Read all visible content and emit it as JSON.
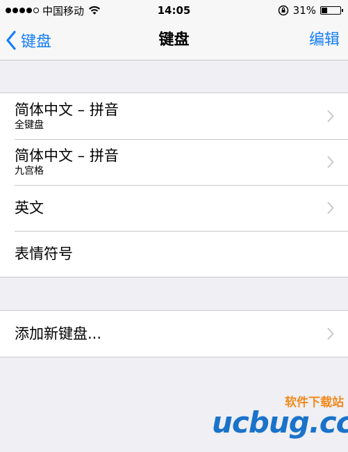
{
  "status_bar": {
    "carrier": "中国移动",
    "time": "14:05",
    "battery": "31%",
    "battery_level": 0.31
  },
  "nav": {
    "back_label": "键盘",
    "title": "键盘",
    "edit_label": "编辑"
  },
  "keyboards": [
    {
      "title": "简体中文 – 拼音",
      "subtitle": "全键盘"
    },
    {
      "title": "简体中文 – 拼音",
      "subtitle": "九宫格"
    },
    {
      "title": "英文"
    },
    {
      "title": "表情符号"
    }
  ],
  "add_keyboard": {
    "label": "添加新键盘..."
  },
  "watermark": {
    "site_name": "软件下载站",
    "logo_text": "ucbug.cc"
  }
}
